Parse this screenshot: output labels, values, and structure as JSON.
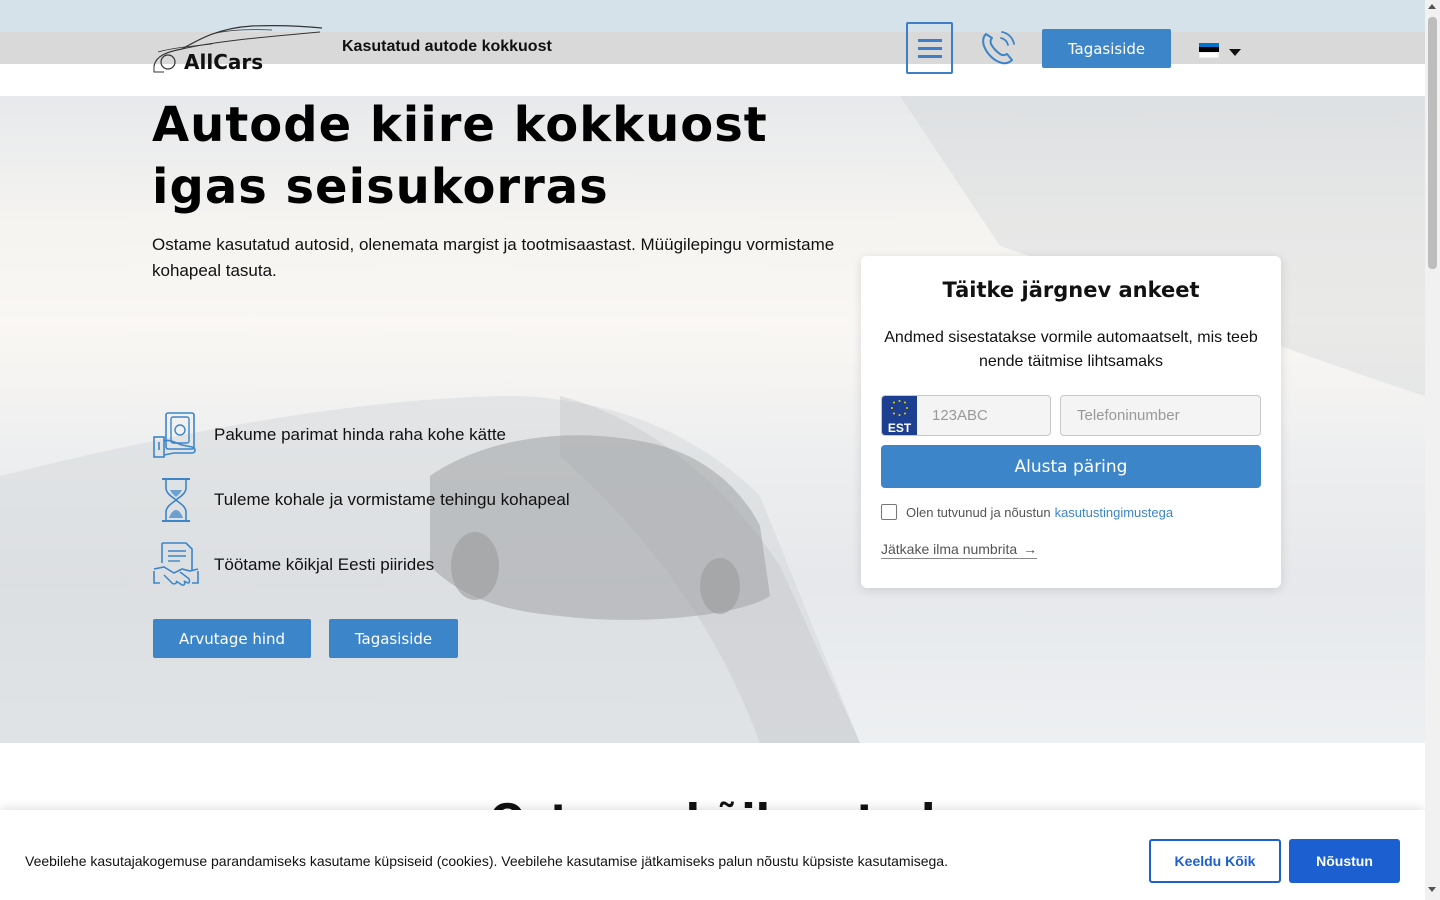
{
  "header": {
    "logo_text": "AllCars",
    "tagline": "Kasutatud autode kokkuost",
    "menu_icon": "hamburger-menu-icon",
    "phone_icon": "phone-icon",
    "feedback_label": "Tagasiside",
    "language_flag": "estonia-flag-icon",
    "language_caret": "caret-down-icon"
  },
  "hero": {
    "title_line1": "Autode kiire kokkuost",
    "title_line2": "igas seisukorras",
    "description": "Ostame kasutatud autosid, olenemata margist ja tootmisaastast. Müügilepingu vormistame kohapeal tasuta.",
    "features": [
      {
        "icon": "money-hand-icon",
        "text": "Pakume parimat hinda raha kohe kätte"
      },
      {
        "icon": "hourglass-icon",
        "text": "Tuleme kohale ja vormistame tehingu kohapeal"
      },
      {
        "icon": "contract-handshake-icon",
        "text": "Töötame kõikjal Eesti piirides"
      }
    ],
    "buttons": {
      "calculate": "Arvutage hind",
      "feedback": "Tagasiside"
    }
  },
  "form": {
    "title": "Täitke järgnev ankeet",
    "subtitle": "Andmed sisestatakse vormile automaatselt, mis teeb nende täitmise lihtsamaks",
    "plate_country": "EST",
    "plate_placeholder": "123ABC",
    "phone_placeholder": "Telefoninumber",
    "submit_label": "Alusta päring",
    "agree_text": "Olen tutvunud ja nõustun",
    "agree_link": "kasutustingimustega",
    "no_plate_link": "Jätkake ilma numbrita",
    "no_plate_arrow": "→"
  },
  "section": {
    "partial_title": "Ostame ... kõik autod"
  },
  "cookie": {
    "text": "Veebilehe kasutajakogemuse parandamiseks kasutame küpsiseid (cookies). Veebilehe kasutamise jätkamiseks palun nõustu küpsiste kasutamisega.",
    "deny_label": "Keeldu Kõik",
    "accept_label": "Nõustun"
  },
  "colors": {
    "accent": "#3d85c9",
    "cookie_accent": "#1b5fd0",
    "topbar": "#d6e2ea",
    "greybar": "#d9d9d9"
  }
}
